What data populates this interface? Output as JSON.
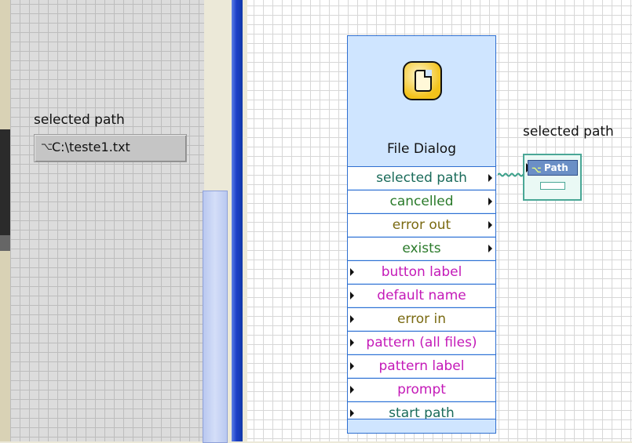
{
  "front_panel": {
    "indicator_label": "selected path",
    "indicator_value": "C:\\teste1.txt",
    "indicator_icon": "path-icon"
  },
  "block_diagram": {
    "express_vi": {
      "title": "File Dialog",
      "icon": "file-dialog-icon",
      "outputs": [
        {
          "label": "selected path",
          "color": "#1a6b5a"
        },
        {
          "label": "cancelled",
          "color": "#2a7a2a"
        },
        {
          "label": "error out",
          "color": "#7a6a12"
        },
        {
          "label": "exists",
          "color": "#2a7a2a"
        }
      ],
      "inputs": [
        {
          "label": "button label",
          "color": "#c41ab8"
        },
        {
          "label": "default name",
          "color": "#c41ab8"
        },
        {
          "label": "error in",
          "color": "#7a6a12"
        },
        {
          "label": "pattern (all files)",
          "color": "#c41ab8"
        },
        {
          "label": "pattern label",
          "color": "#c41ab8"
        },
        {
          "label": "prompt",
          "color": "#c41ab8"
        },
        {
          "label": "start path",
          "color": "#1a6b5a"
        }
      ]
    },
    "indicator": {
      "label": "selected path",
      "tag": "Path"
    }
  },
  "colors": {
    "divider": "#1c3fc7",
    "vi_background": "#cfe5ff",
    "path_wire": "#3aa08a"
  }
}
